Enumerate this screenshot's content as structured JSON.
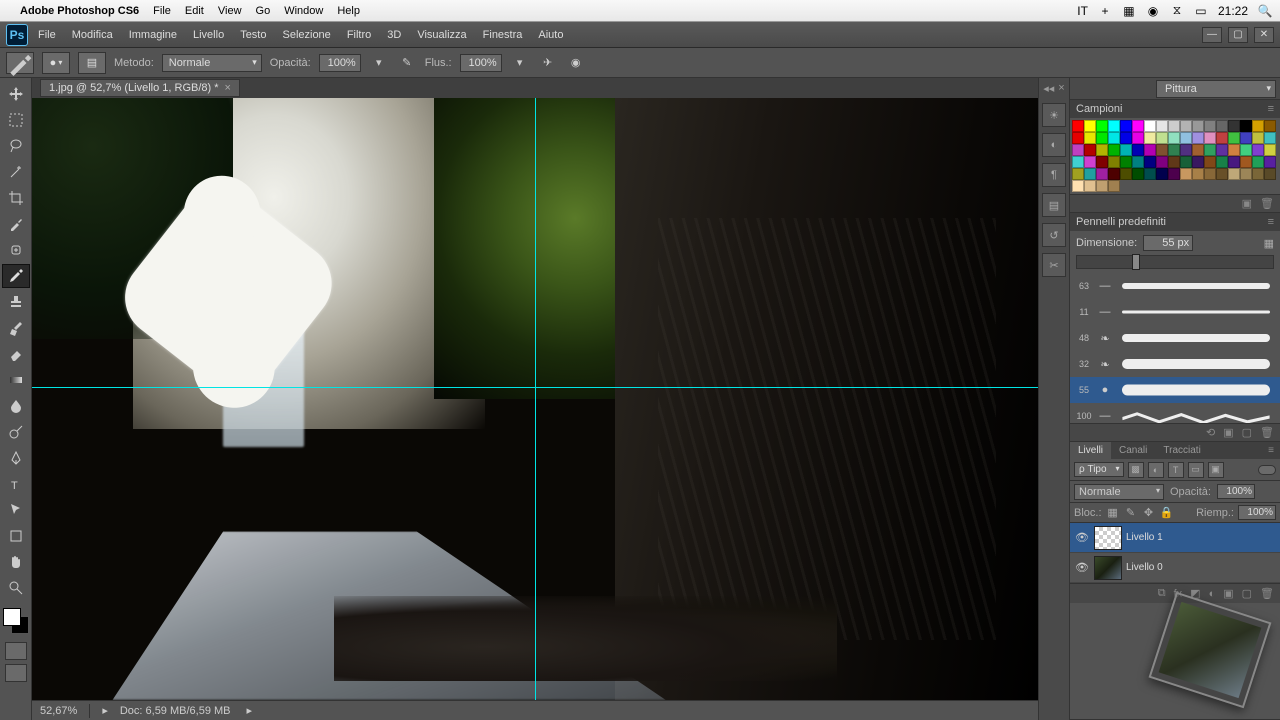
{
  "mac": {
    "app_name": "Adobe Photoshop CS6",
    "menu": [
      "File",
      "Edit",
      "View",
      "Go",
      "Window",
      "Help"
    ],
    "lang": "IT",
    "time": "21:22"
  },
  "ps_menu": [
    "File",
    "Modifica",
    "Immagine",
    "Livello",
    "Testo",
    "Selezione",
    "Filtro",
    "3D",
    "Visualizza",
    "Finestra",
    "Aiuto"
  ],
  "workspace": "Pittura",
  "options": {
    "metodo_label": "Metodo:",
    "metodo_value": "Normale",
    "opacita_label": "Opacità:",
    "opacita_value": "100%",
    "flusso_label": "Flus.:",
    "flusso_value": "100%"
  },
  "doc": {
    "tab": "1.jpg @ 52,7% (Livello 1, RGB/8) *",
    "zoom": "52,67%",
    "docsize": "Doc: 6,59 MB/6,59 MB"
  },
  "swatches": {
    "title": "Campioni",
    "colors": [
      "#ff0000",
      "#ffff00",
      "#00ff00",
      "#00ffff",
      "#0000ff",
      "#ff00ff",
      "#ffffff",
      "#e6e6e6",
      "#cccccc",
      "#b3b3b3",
      "#999999",
      "#808080",
      "#666666",
      "#333333",
      "#000000",
      "#d4a000",
      "#8a5a00",
      "#e60000",
      "#e6e600",
      "#00e600",
      "#00e6e6",
      "#0000e6",
      "#e600e6",
      "#f0eaa0",
      "#c0e090",
      "#90e0c0",
      "#90c0e0",
      "#a090e0",
      "#e090c0",
      "#c04040",
      "#40c040",
      "#4040c0",
      "#c0c040",
      "#40c0c0",
      "#c040c0",
      "#b30000",
      "#b3b300",
      "#00b300",
      "#00b3b3",
      "#0000b3",
      "#b300b3",
      "#805030",
      "#308050",
      "#503080",
      "#a06030",
      "#30a060",
      "#6030a0",
      "#d08040",
      "#40d080",
      "#8040d0",
      "#d0d040",
      "#40d0d0",
      "#d040d0",
      "#800000",
      "#808000",
      "#008000",
      "#008080",
      "#000080",
      "#800080",
      "#603818",
      "#186038",
      "#381860",
      "#804818",
      "#188048",
      "#481880",
      "#a05820",
      "#20a058",
      "#5820a0",
      "#a0a020",
      "#20a0a0",
      "#a020a0",
      "#4d0000",
      "#4d4d00",
      "#004d00",
      "#004d4d",
      "#00004d",
      "#4d004d",
      "#c89860",
      "#a88048",
      "#886838",
      "#685028",
      "#bfa878",
      "#9c8658",
      "#7a6638",
      "#594a28",
      "#ffe0b0",
      "#e0c090",
      "#c0a070",
      "#a08050"
    ]
  },
  "brushes": {
    "title": "Pennelli predefiniti",
    "size_label": "Dimensione:",
    "size_value": "55 px",
    "items": [
      {
        "num": "63",
        "th": 6,
        "icon": "line"
      },
      {
        "num": "11",
        "th": 3,
        "icon": "line"
      },
      {
        "num": "48",
        "th": 8,
        "icon": "leaf"
      },
      {
        "num": "32",
        "th": 10,
        "icon": "leaf"
      },
      {
        "num": "55",
        "th": 11,
        "icon": "circle",
        "selected": true
      },
      {
        "num": "100",
        "th": 8,
        "icon": "line",
        "wavy": true
      }
    ]
  },
  "layers": {
    "tabs": [
      "Livelli",
      "Canali",
      "Tracciati"
    ],
    "filter_kind": "ρ Tipo",
    "blend_mode": "Normale",
    "opacita_label": "Opacità:",
    "opacita_value": "100%",
    "blocca_label": "Bloc.:",
    "riempi_label": "Riemp.:",
    "riempi_value": "100%",
    "items": [
      {
        "name": "Livello 1",
        "transparent": true,
        "selected": true
      },
      {
        "name": "Livello 0",
        "transparent": false
      }
    ]
  }
}
